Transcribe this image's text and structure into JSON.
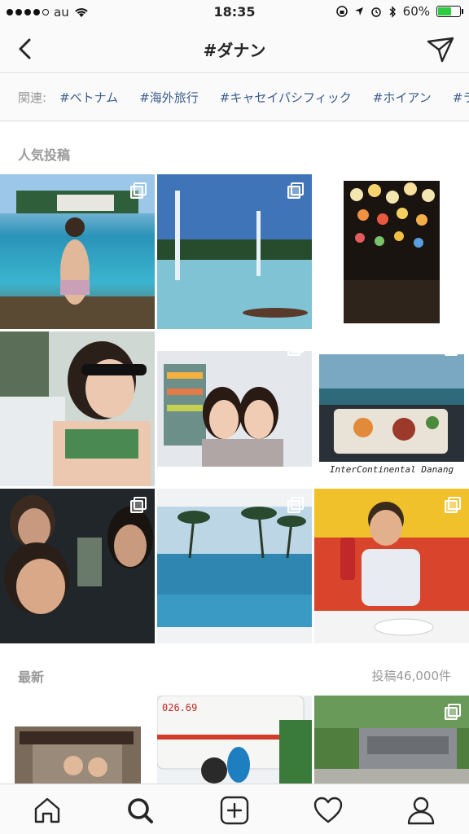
{
  "status_bar": {
    "carrier": "au",
    "time": "18:35",
    "battery": "60%",
    "battery_level": 0.6
  },
  "header": {
    "title": "#ダナン",
    "back_icon": "chevron-left-icon",
    "send_icon": "paper-plane-icon"
  },
  "related": {
    "label": "関連:",
    "tags": [
      "#ベトナム",
      "#海外旅行",
      "#キャセイパシフィック",
      "#ホイアン",
      "#ラ"
    ]
  },
  "top_posts": {
    "title": "人気投稿",
    "tiles": [
      {
        "desc": "infinity pool, woman in bikini",
        "multi": true
      },
      {
        "desc": "fountains and pool, palm trees",
        "multi": true
      },
      {
        "desc": "hoi an lanterns street at night",
        "multi": true
      },
      {
        "desc": "woman in sunglasses, green bikini",
        "multi": false
      },
      {
        "desc": "two women in shop",
        "multi": true
      },
      {
        "desc": "food tray over sea view",
        "multi": true,
        "caption": "InterContinental Danang"
      },
      {
        "desc": "group selfie at night",
        "multi": true
      },
      {
        "desc": "infinity pool with palm trees",
        "multi": true
      },
      {
        "desc": "smiling man with drink",
        "multi": true
      }
    ]
  },
  "recent": {
    "title": "最新",
    "count": "投稿46,000件",
    "tiles": [
      {
        "desc": "temple and people selfie",
        "multi": true
      },
      {
        "desc": "white bus with dolphin bin",
        "multi": false,
        "caption": "026.69"
      },
      {
        "desc": "stone sign with trees",
        "multi": true
      }
    ]
  },
  "nav": {
    "items": [
      "home-icon",
      "search-icon",
      "add-post-icon",
      "heart-icon",
      "profile-icon"
    ]
  }
}
